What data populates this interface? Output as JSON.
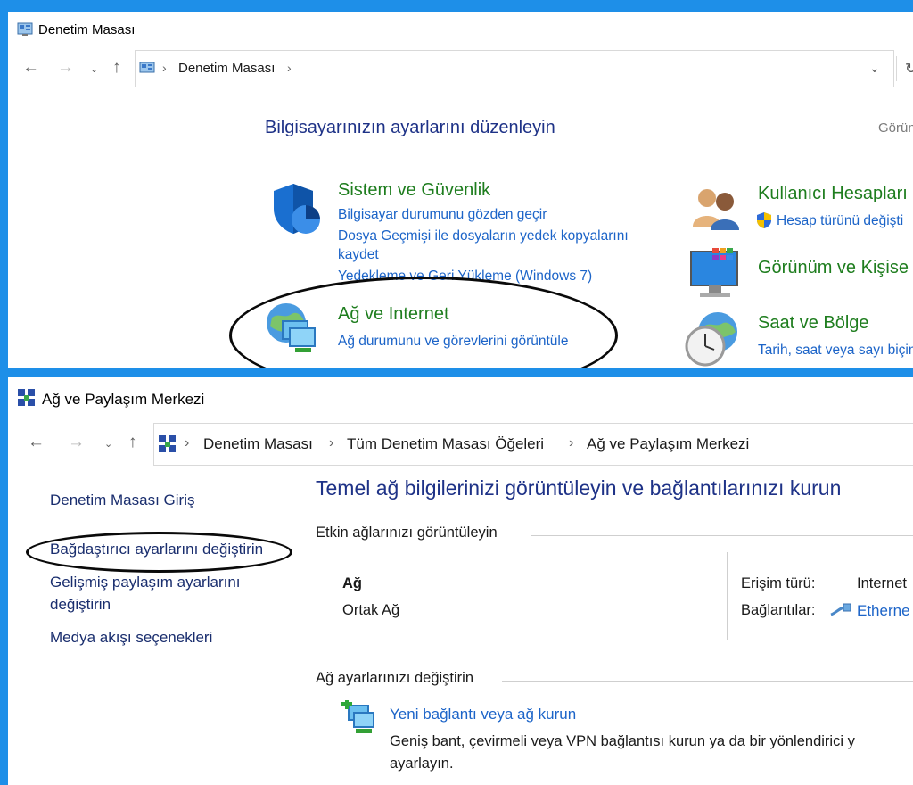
{
  "window1": {
    "title": "Denetim Masası",
    "breadcrumb": [
      "Denetim Masası"
    ],
    "heading": "Bilgisayarınızın ayarlarını düzenleyin",
    "view_label": "Görün",
    "categories": {
      "system": {
        "title": "Sistem ve Güvenlik",
        "links": [
          "Bilgisayar durumunu gözden geçir",
          "Dosya Geçmişi ile dosyaların yedek kopyalarını",
          "kaydet",
          "Yedekleme ve Geri Yükleme (Windows 7)"
        ]
      },
      "network": {
        "title": "Ağ ve Internet",
        "links": [
          "Ağ durumunu ve görevlerini görüntüle"
        ]
      },
      "users": {
        "title": "Kullanıcı Hesapları",
        "links": [
          "Hesap türünü değişti"
        ]
      },
      "appearance": {
        "title": "Görünüm ve Kişise"
      },
      "clock": {
        "title": "Saat ve Bölge",
        "links": [
          "Tarih, saat veya sayı biçim"
        ]
      }
    }
  },
  "window2": {
    "title": "Ağ ve Paylaşım Merkezi",
    "breadcrumb": [
      "Denetim Masası",
      "Tüm Denetim Masası Öğeleri",
      "Ağ ve Paylaşım Merkezi"
    ],
    "sidebar": [
      "Denetim Masası Giriş",
      "Bağdaştırıcı ayarlarını değiştirin",
      "Gelişmiş paylaşım ayarlarını",
      "değiştirin",
      "Medya akışı seçenekleri"
    ],
    "heading": "Temel ağ bilgilerinizi görüntüleyin ve bağlantılarınızı kurun",
    "active_networks_label": "Etkin ağlarınızı görüntüleyin",
    "network_name": "Ağ",
    "network_type": "Ortak Ağ",
    "access_type_label": "Erişim türü:",
    "access_type_value": "Internet",
    "connections_label": "Bağlantılar:",
    "connections_value": "Etherne",
    "change_settings_label": "Ağ ayarlarınızı değiştirin",
    "new_connection_link": "Yeni bağlantı veya ağ kurun",
    "new_connection_desc": [
      "Geniş bant, çevirmeli veya VPN bağlantısı kurun ya da bir yönlendirici y",
      "ayarlayın."
    ]
  },
  "colors": {
    "desktop": "#1e8fe8",
    "link_blue": "#1c64c8",
    "category_green": "#1e7d1e",
    "heading_navy": "#1e3287"
  }
}
